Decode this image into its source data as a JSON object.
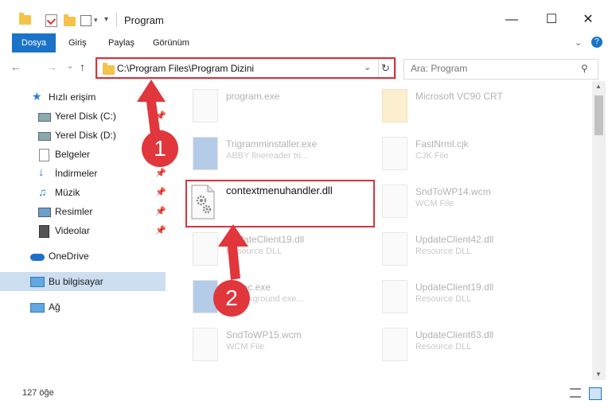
{
  "window": {
    "title": "Program"
  },
  "ribbon": {
    "tabs": [
      "Dosya",
      "Giriş",
      "Paylaş",
      "Görünüm"
    ]
  },
  "address": {
    "path": "C:\\Program Files\\Program Dizini"
  },
  "search": {
    "placeholder": "Ara: Program"
  },
  "sidebar": {
    "items": [
      {
        "label": "Hızlı erişim",
        "icon": "star-icon"
      },
      {
        "label": "Yerel Disk (C:)",
        "icon": "drive-icon"
      },
      {
        "label": "Yerel Disk (D:)",
        "icon": "drive-icon"
      },
      {
        "label": "Belgeler",
        "icon": "document-icon"
      },
      {
        "label": "İndirmeler",
        "icon": "download-icon"
      },
      {
        "label": "Müzik",
        "icon": "music-icon"
      },
      {
        "label": "Resimler",
        "icon": "pictures-icon"
      },
      {
        "label": "Videolar",
        "icon": "video-icon"
      },
      {
        "label": "OneDrive",
        "icon": "cloud-icon"
      },
      {
        "label": "Bu bilgisayar",
        "icon": "computer-icon"
      },
      {
        "label": "Ağ",
        "icon": "network-icon"
      }
    ]
  },
  "files": [
    {
      "name": "program.exe",
      "sub": ""
    },
    {
      "name": "Microsoft VC90 CRT",
      "sub": ""
    },
    {
      "name": "Trigramminstaller.exe",
      "sub": "ABBY finereader tri..."
    },
    {
      "name": "FastNrml.cjk",
      "sub": "CJK File"
    },
    {
      "name": "SndToWP14.wcm",
      "sub": "WCM File"
    },
    {
      "name": "UpdateClient19.dll",
      "sub": "Resource DLL"
    },
    {
      "name": "UpdateClient42.dll",
      "sub": "Resource DLL"
    },
    {
      "name": "eExec.exe",
      "sub": "Y background exe..."
    },
    {
      "name": "UpdateClient19.dll",
      "sub": "Resource DLL"
    },
    {
      "name": "SndToWP15.wcm",
      "sub": "WCM File"
    },
    {
      "name": "UpdateClient63.dll",
      "sub": "Resource DLL"
    }
  ],
  "highlighted_file": {
    "name": "contextmenuhandler.dll"
  },
  "status": {
    "count": "127 öğe"
  },
  "annotations": {
    "badge1": "1",
    "badge2": "2"
  },
  "colors": {
    "accent": "#1a73c8",
    "annotation_red": "#e0363c"
  }
}
